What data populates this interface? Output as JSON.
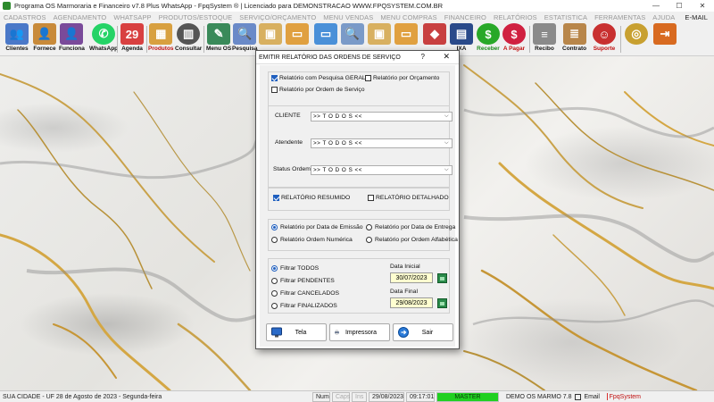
{
  "window": {
    "title": "Programa OS Marmoraria e Financeiro v7.8 Plus WhatsApp - FpqSystem ® | Licenciado para  DEMONSTRACAO WWW.FPQSYSTEM.COM.BR",
    "minimize": "—",
    "maximize": "☐",
    "close": "✕"
  },
  "menu": {
    "items": [
      "CADASTROS",
      "AGENDAMENTO",
      "WHATSAPP",
      "PRODUTOS/ESTOQUE",
      "SERVIÇO/ORÇAMENTO",
      "MENU VENDAS",
      "MENU COMPRAS",
      "FINANCEIRO",
      "RELATÓRIOS",
      "ESTATISTICA",
      "FERRAMENTAS",
      "AJUDA"
    ],
    "email": "E-MAIL"
  },
  "toolbar": {
    "buttons": [
      {
        "label": "Clientes",
        "icon": "clients-icon",
        "color": "#4a78c8"
      },
      {
        "label": "Fornece",
        "icon": "supplier-icon",
        "color": "#c88a3a"
      },
      {
        "label": "Funciona",
        "icon": "employee-icon",
        "color": "#7a4a9a"
      },
      {
        "label": "WhatsApp",
        "icon": "whatsapp-icon",
        "color": "#25d366"
      },
      {
        "label": "Agenda",
        "icon": "calendar-icon",
        "color": "#d84040"
      },
      {
        "label": "Produtos",
        "icon": "products-icon",
        "color": "#d8a040"
      },
      {
        "label": "Consultar",
        "icon": "barcode-icon",
        "color": "#555555"
      },
      {
        "label": "Menu OS",
        "icon": "service-order-icon",
        "color": "#3a8a5a"
      },
      {
        "label": "Pesquisa",
        "icon": "search-doc-icon",
        "color": "#6a8ac8"
      },
      {
        "label": "",
        "icon": "box-icon",
        "color": "#d8b060"
      },
      {
        "label": "",
        "icon": "folder-icon",
        "color": "#e0a040"
      },
      {
        "label": "",
        "icon": "monitor-icon",
        "color": "#4a90d8"
      },
      {
        "label": "",
        "icon": "search-doc-icon",
        "color": "#7a9ac8"
      },
      {
        "label": "",
        "icon": "box-icon",
        "color": "#d8b060"
      },
      {
        "label": "",
        "icon": "folder-icon",
        "color": "#e0a040"
      },
      {
        "label": "",
        "icon": "gift-icon",
        "color": "#c84040"
      },
      {
        "label": "IXA",
        "icon": "book-icon",
        "color": "#2a4a8a"
      },
      {
        "label": "Receber",
        "icon": "receive-money-icon",
        "color": "#28a828"
      },
      {
        "label": "A Pagar",
        "icon": "pay-money-icon",
        "color": "#d02040"
      },
      {
        "label": "Recibo",
        "icon": "receipt-icon",
        "color": "#8a8a8a"
      },
      {
        "label": "Contrato",
        "icon": "contract-icon",
        "color": "#b8864a"
      },
      {
        "label": "Suporte",
        "icon": "support-icon",
        "color": "#c83030"
      },
      {
        "label": "",
        "icon": "coins-icon",
        "color": "#c8a030"
      },
      {
        "label": "",
        "icon": "exit-icon",
        "color": "#d86a20"
      }
    ]
  },
  "dialog": {
    "title": "EMITIR RELATÓRIO DAS ORDENS DE SERVIÇO",
    "help": "?",
    "close": "✕",
    "report_type": {
      "geral": {
        "label": "Relatório com Pesquisa GERAL",
        "checked": true
      },
      "orcamento": {
        "label": "Relatório por Orçamento",
        "checked": false
      },
      "ordem": {
        "label": "Relatório por Ordem de Serviço",
        "checked": false
      }
    },
    "filters": {
      "cliente": {
        "label": "CLIENTE",
        "value": ">> T O D O S <<"
      },
      "atendente": {
        "label": "Atendente",
        "value": ">> T O D O S <<"
      },
      "status": {
        "label": "Status Ordem",
        "value": ">> T O D O S <<"
      }
    },
    "detail": {
      "resumido": {
        "label": "RELATÓRIO RESUMIDO",
        "checked": true
      },
      "detalhado": {
        "label": "RELATÓRIO DETALHADO",
        "checked": false
      }
    },
    "sort": {
      "emissao": {
        "label": "Relatório por Data de Emissão",
        "selected": true
      },
      "entrega": {
        "label": "Relatório por Data de Entrega",
        "selected": false
      },
      "numerica": {
        "label": "Relatório Ordem Numérica",
        "selected": false
      },
      "alfabetica": {
        "label": "Relatório por Ordem Alfabética",
        "selected": false
      }
    },
    "status_filter": {
      "todos": {
        "label": "Filtrar TODOS",
        "selected": true
      },
      "pendentes": {
        "label": "Filtrar PENDENTES",
        "selected": false
      },
      "cancelados": {
        "label": "Filtrar CANCELADOS",
        "selected": false
      },
      "finalizados": {
        "label": "Filtrar FINALIZADOS",
        "selected": false
      }
    },
    "dates": {
      "start_label": "Data Inicial",
      "start_value": "30/07/2023",
      "end_label": "Data Final",
      "end_value": "29/08/2023"
    },
    "buttons": {
      "tela": "Tela",
      "impressora": "Impressora",
      "sair": "Sair"
    }
  },
  "statusbar": {
    "location": "SUA CIDADE - UF 28 de Agosto de 2023 - Segunda-feira",
    "num": "Num",
    "caps": "Caps",
    "ins": "Ins",
    "date": "29/08/2023",
    "time": "09:17:01",
    "master": "MASTER",
    "company": "DEMO OS MARMO 7.8",
    "email": "Email",
    "brand": "FpqSystem"
  }
}
